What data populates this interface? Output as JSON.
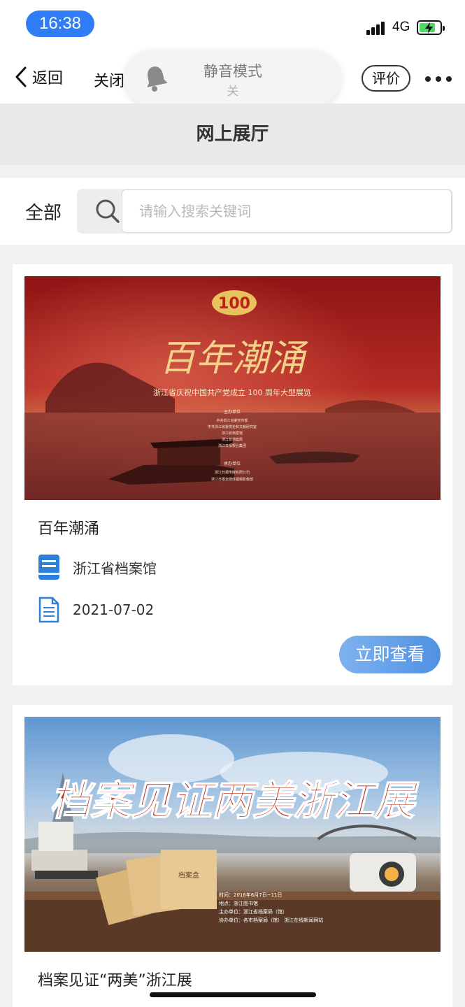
{
  "status_bar": {
    "time": "16:38",
    "network": "4G",
    "accent": "#2f7cf6"
  },
  "nav": {
    "back_label": "返回",
    "close_label": "关闭",
    "rate_label": "评价",
    "more_icon": "more-icon"
  },
  "silent_toast": {
    "title": "静音模式",
    "subtitle": "关"
  },
  "page": {
    "title": "网上展厅"
  },
  "search": {
    "category": "全部",
    "placeholder": "请输入搜索关键词",
    "value": ""
  },
  "exhibitions": [
    {
      "title": "百年潮涌",
      "organizer": "浙江省档案馆",
      "date": "2021-07-02",
      "view_label": "立即查看",
      "banner": {
        "logo_text": "100",
        "headline": "百年潮涌",
        "subtitle": "浙江省庆祝中国共产党成立 100 周年大型展览",
        "host_label": "主办单位",
        "hosts": [
          "中共浙江省委宣传部",
          "中共浙江省委党史和文献研究室",
          "浙江省档案馆",
          "浙江省档案局",
          "浙江日报报业集团"
        ],
        "co_label": "承办单位",
        "co_hosts": [
          "浙江日报传媒有限公司",
          "浙江日报全媒体视频影像部"
        ]
      }
    },
    {
      "title": "档案见证“两美”浙江展",
      "banner": {
        "headline": "档案见证两美浙江展",
        "folder_label": "档案盒",
        "info": [
          "时间：2016年6月7日~11日",
          "地点：浙江图书馆",
          "主办单位：浙江省档案局（馆）",
          "协办单位：各市档案局（馆）  浙江在线新闻网站"
        ]
      }
    }
  ]
}
